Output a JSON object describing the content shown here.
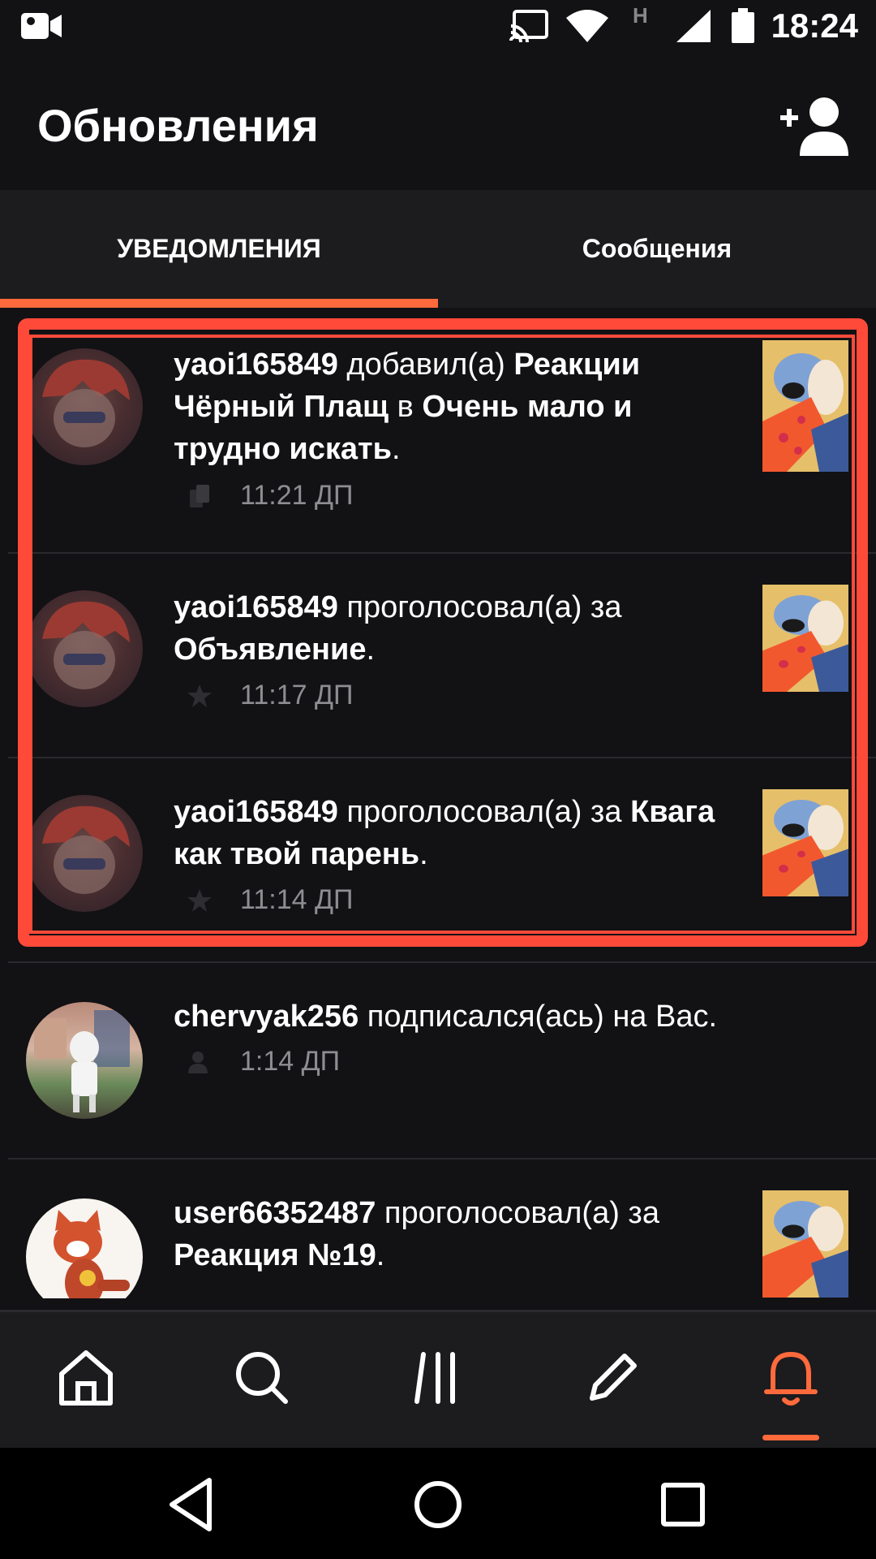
{
  "status_bar": {
    "time": "18:24",
    "network_label": "H",
    "icons": [
      "video-camera-icon",
      "cast-icon",
      "wifi-icon",
      "signal-icon",
      "battery-icon"
    ]
  },
  "app_bar": {
    "title": "Обновления",
    "add_friend_icon": "add-person-icon"
  },
  "tabs": [
    {
      "label": "УВЕДОМЛЕНИЯ",
      "active": true
    },
    {
      "label": "Сообщения",
      "active": false
    }
  ],
  "accent_color": "#ff6a3c",
  "highlight_color": "#ff4a3a",
  "notifications": [
    {
      "user": "yaoi165849",
      "action": "добавил(а)",
      "object": "Реакции Чёрный Плащ",
      "connector": "в",
      "target": "Очень мало и трудно искать",
      "end": ".",
      "time": "11:21 ДП",
      "type_icon": "reading-list-icon"
    },
    {
      "user": "yaoi165849",
      "action": "проголосовал(а) за",
      "object": "Объявление",
      "end": ".",
      "time": "11:17 ДП",
      "type_icon": "star-icon"
    },
    {
      "user": "yaoi165849",
      "action": "проголосовал(а) за",
      "object": "Квага как твой парень",
      "end": ".",
      "time": "11:14 ДП",
      "type_icon": "star-icon"
    },
    {
      "user": "chervyak256",
      "action": "подписался(ась) на Вас.",
      "time": "1:14 ДП",
      "type_icon": "follow-icon"
    },
    {
      "user": "user66352487",
      "action": "проголосовал(а) за",
      "object": "Реакция №19",
      "end": ".",
      "type_icon": "star-icon"
    }
  ],
  "bottom_nav": [
    {
      "name": "home",
      "icon": "home-icon",
      "active": false
    },
    {
      "name": "search",
      "icon": "search-icon",
      "active": false
    },
    {
      "name": "library",
      "icon": "library-icon",
      "active": false
    },
    {
      "name": "write",
      "icon": "pencil-icon",
      "active": false
    },
    {
      "name": "notifications",
      "icon": "bell-icon",
      "active": true
    }
  ],
  "system_nav": [
    "back-icon",
    "home-circle-icon",
    "recents-icon"
  ]
}
